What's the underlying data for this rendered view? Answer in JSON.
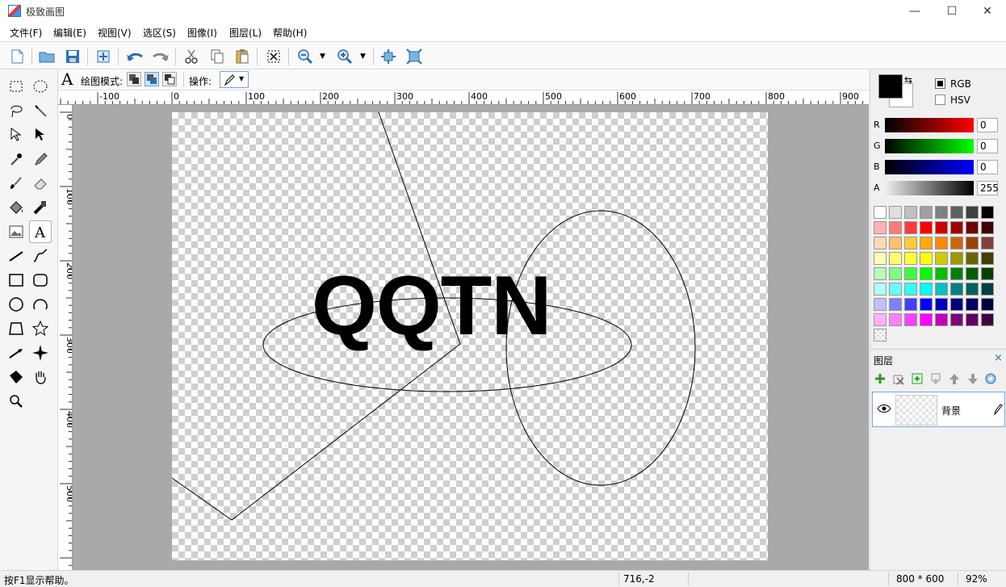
{
  "window": {
    "title": "极致画图",
    "minimize": "—",
    "maximize": "☐",
    "close": "✕"
  },
  "menu": [
    "文件(F)",
    "编辑(E)",
    "视图(V)",
    "选区(S)",
    "图像(I)",
    "图层(L)",
    "帮助(H)"
  ],
  "toolbar": {
    "buttons": [
      "new-file-icon",
      "open-folder-icon",
      "save-icon",
      "resize-icon",
      "undo-icon",
      "redo-icon",
      "cut-icon",
      "copy-icon",
      "paste-icon",
      "deselect-icon",
      "zoom-out-icon",
      "zoom-in-icon",
      "fit-window-icon",
      "actual-size-icon"
    ]
  },
  "tools": [
    "rect-select",
    "ellipse-select",
    "lasso",
    "magic-wand",
    "move-selection",
    "move-pixels",
    "color-picker",
    "pencil",
    "brush",
    "eraser",
    "bucket-fill",
    "stamp",
    "image",
    "text",
    "line",
    "curve",
    "rectangle",
    "rounded-rectangle",
    "ellipse",
    "arc",
    "polygon",
    "star",
    "arrow",
    "sparkle",
    "diamond-shape",
    "hand",
    "zoom"
  ],
  "options": {
    "mode_label": "绘图模式:",
    "op_label": "操作:"
  },
  "ruler": {
    "h_ticks": [
      "-100",
      "0",
      "100",
      "200",
      "300",
      "400",
      "500",
      "600",
      "700",
      "800",
      "900"
    ],
    "v_ticks": [
      "0",
      "100",
      "200",
      "300",
      "400",
      "500"
    ]
  },
  "canvas": {
    "text": "QQTN"
  },
  "color": {
    "rgb_label": "RGB",
    "hsv_label": "HSV",
    "channels": [
      {
        "label": "R",
        "value": "0"
      },
      {
        "label": "G",
        "value": "0"
      },
      {
        "label": "B",
        "value": "0"
      },
      {
        "label": "A",
        "value": "255"
      }
    ],
    "foreground": "#000000",
    "palette": [
      [
        "#ffffff",
        "#e0e0e0",
        "#c0c0c0",
        "#a0a0a0",
        "#808080",
        "#606060",
        "#404040",
        "#000000"
      ],
      [
        "#ffb3b3",
        "#ff7a7a",
        "#ff3c3c",
        "#ff0000",
        "#d00000",
        "#a00000",
        "#700000",
        "#400000"
      ],
      [
        "#ffd9b3",
        "#ffc266",
        "#ffcc33",
        "#ffaa00",
        "#ff8800",
        "#cc6600",
        "#994400",
        "#804040"
      ],
      [
        "#ffffb3",
        "#ffff66",
        "#ffff33",
        "#ffff00",
        "#cccc00",
        "#999900",
        "#666600",
        "#404000"
      ],
      [
        "#b3ffb3",
        "#80ff80",
        "#40ff40",
        "#00ff00",
        "#00c000",
        "#008000",
        "#006000",
        "#004000"
      ],
      [
        "#b3ffff",
        "#66ffff",
        "#33ffff",
        "#00ffff",
        "#00c0c0",
        "#008080",
        "#006060",
        "#004040"
      ],
      [
        "#c0c0ff",
        "#8080ff",
        "#4040ff",
        "#0000ff",
        "#0000c0",
        "#000080",
        "#000060",
        "#000040"
      ],
      [
        "#ffb3ff",
        "#ff80ff",
        "#ff40ff",
        "#ff00ff",
        "#c000c0",
        "#800080",
        "#600060",
        "#400040"
      ]
    ]
  },
  "layers": {
    "title": "图层",
    "close": "×",
    "items": [
      {
        "name": "背景"
      }
    ]
  },
  "status": {
    "help": "按F1显示帮助。",
    "coords": "716,-2",
    "size": "800 * 600",
    "zoom": "92%"
  }
}
